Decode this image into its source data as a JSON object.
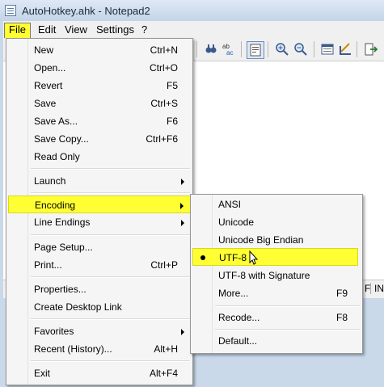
{
  "window": {
    "title": "AutoHotkey.ahk - Notepad2"
  },
  "menubar": [
    "File",
    "Edit",
    "View",
    "Settings",
    "?"
  ],
  "colors": {
    "highlight": "#ffff33"
  },
  "toolbar_icons": [
    "find-icon",
    "replace-icon",
    "wordwrap-icon",
    "zoom-in-icon",
    "zoom-out-icon",
    "schemes-icon",
    "customize-icon",
    "exit-icon"
  ],
  "status": {
    "seg1": "F",
    "seg2": "IN"
  },
  "file_menu": {
    "items": [
      {
        "label": "New",
        "key": "Ctrl+N"
      },
      {
        "label": "Open...",
        "key": "Ctrl+O"
      },
      {
        "label": "Revert",
        "key": "F5"
      },
      {
        "label": "Save",
        "key": "Ctrl+S"
      },
      {
        "label": "Save As...",
        "key": "F6"
      },
      {
        "label": "Save Copy...",
        "key": "Ctrl+F6"
      },
      {
        "label": "Read Only",
        "key": ""
      },
      {
        "label": "Launch",
        "key": ""
      },
      {
        "label": "Encoding",
        "key": ""
      },
      {
        "label": "Line Endings",
        "key": ""
      },
      {
        "label": "Page Setup...",
        "key": ""
      },
      {
        "label": "Print...",
        "key": "Ctrl+P"
      },
      {
        "label": "Properties...",
        "key": ""
      },
      {
        "label": "Create Desktop Link",
        "key": ""
      },
      {
        "label": "Favorites",
        "key": ""
      },
      {
        "label": "Recent (History)...",
        "key": "Alt+H"
      },
      {
        "label": "Exit",
        "key": "Alt+F4"
      }
    ]
  },
  "encoding_menu": {
    "items": [
      {
        "label": "ANSI",
        "key": ""
      },
      {
        "label": "Unicode",
        "key": ""
      },
      {
        "label": "Unicode Big Endian",
        "key": ""
      },
      {
        "label": "UTF-8",
        "key": "",
        "selected": true
      },
      {
        "label": "UTF-8 with Signature",
        "key": ""
      },
      {
        "label": "More...",
        "key": "F9"
      },
      {
        "label": "Recode...",
        "key": "F8"
      },
      {
        "label": "Default...",
        "key": ""
      }
    ]
  }
}
